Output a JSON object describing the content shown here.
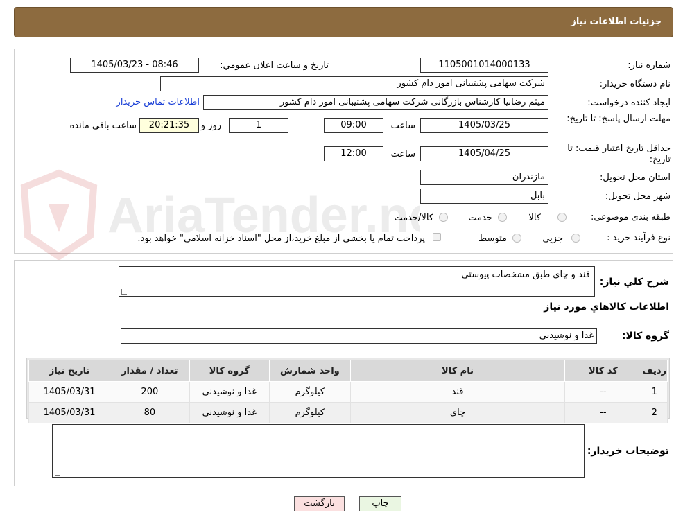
{
  "header": {
    "title": "جزئيات اطلاعات نياز"
  },
  "need": {
    "number_label": "شماره نياز:",
    "number": "1105001014000133",
    "announce_label": "تاريخ و ساعت اعلان عمومي:",
    "announce_value": "1405/03/23 - 08:46",
    "buyer_label": "نام دستگاه خريدار:",
    "buyer_value": "شرکت سهامی پشتیبانی امور دام کشور",
    "creator_label": "ايجاد کننده درخواست:",
    "creator_value": "میثم رضانیا کارشناس بازرگانی شرکت سهامی پشتیبانی امور دام کشور",
    "contact_link": "اطلاعات تماس خريدار",
    "deadline_label": "مهلت ارسال پاسخ: تا تاريخ:",
    "deadline_date": "1405/03/25",
    "time_label": "ساعت",
    "deadline_time": "09:00",
    "days_value": "1",
    "days_label": "روز و",
    "remaining_value": "20:21:35",
    "remaining_label": "ساعت باقي مانده",
    "validity_label": "حداقل تاريخ اعتبار قيمت: تا تاريخ:",
    "validity_date": "1405/04/25",
    "validity_time": "12:00",
    "province_label": "استان محل تحويل:",
    "province_value": "مازندران",
    "city_label": "شهر محل تحويل:",
    "city_value": "بابل",
    "category_label": "طبقه بندی موضوعی:",
    "category_options": [
      "کالا",
      "خدمت",
      "کالا/خدمت"
    ],
    "process_label": "نوع فرآيند خريد :",
    "process_options": [
      "جزيي",
      "متوسط"
    ],
    "payment_note": "پرداخت تمام يا بخشی از مبلغ خريد،از محل \"اسناد خزانه اسلامی\" خواهد بود."
  },
  "summary": {
    "desc_label": "شرح کلي نياز:",
    "desc_value": "قند و چای طبق مشخصات پیوستی",
    "goods_title": "اطلاعات کالاهاي مورد نياز",
    "group_label": "گروه کالا:",
    "group_value": "غذا و نوشیدنی"
  },
  "table": {
    "headers": [
      "رديف",
      "کد کالا",
      "نام کالا",
      "واحد شمارش",
      "گروه کالا",
      "تعداد / مقدار",
      "تاريخ نياز"
    ],
    "rows": [
      [
        "1",
        "--",
        "قند",
        "کیلوگرم",
        "غذا و نوشیدنی",
        "200",
        "1405/03/31"
      ],
      [
        "2",
        "--",
        "چای",
        "کیلوگرم",
        "غذا و نوشیدنی",
        "80",
        "1405/03/31"
      ]
    ]
  },
  "notes": {
    "label": "توضيحات خريدار:",
    "value": ""
  },
  "buttons": {
    "print": "چاپ",
    "back": "بازگشت"
  },
  "watermark": {
    "text": "AriaTender.neT"
  },
  "colors": {
    "header_bg": "#8d6b3f",
    "print_bg": "#eaf6e2",
    "back_bg": "#fbe0e0",
    "link": "#1a3fd6"
  }
}
